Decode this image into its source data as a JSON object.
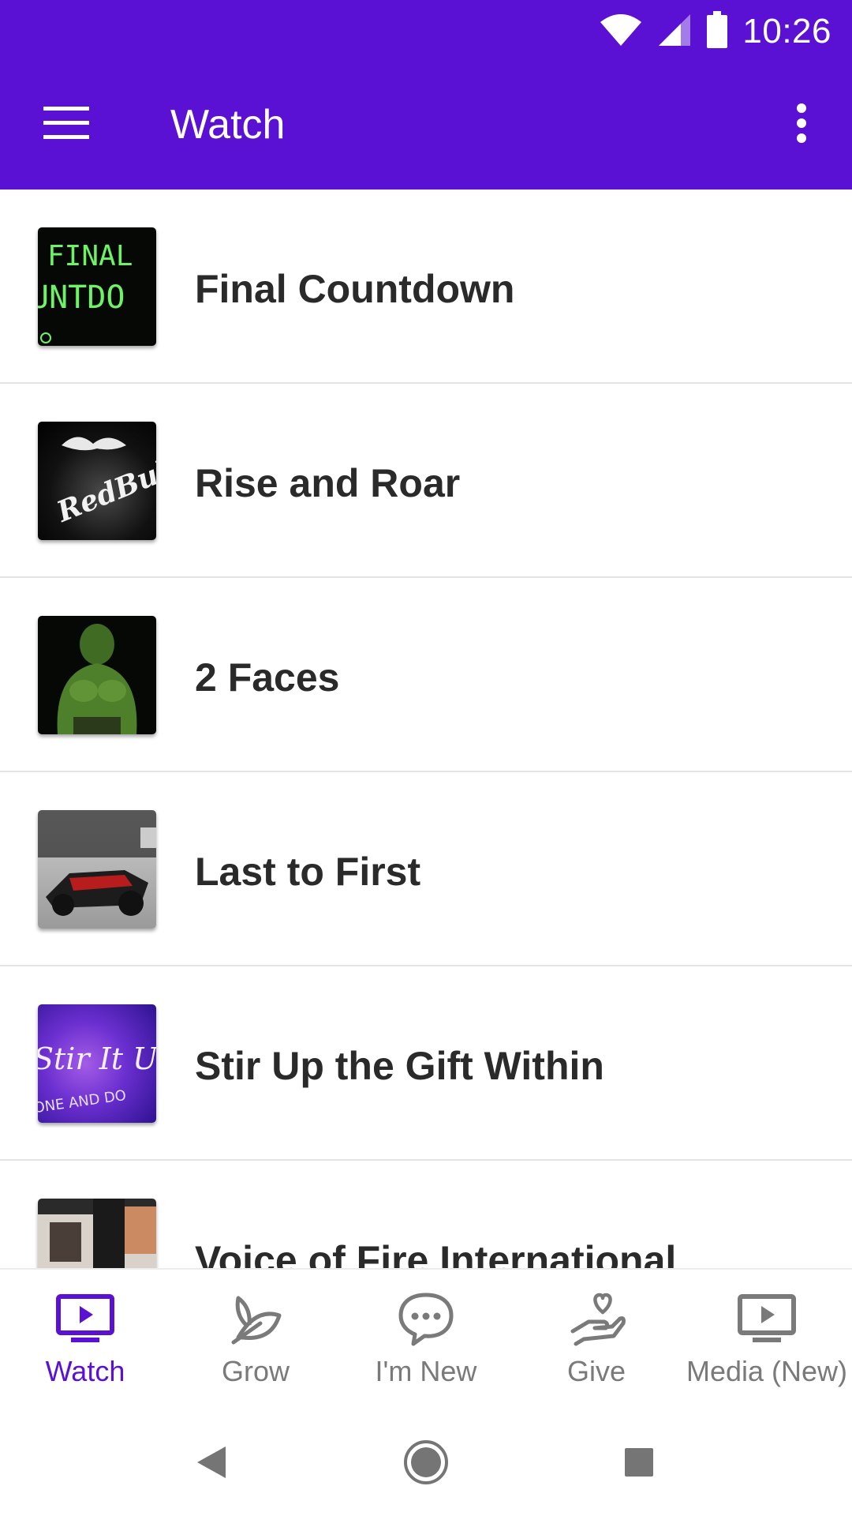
{
  "status_bar": {
    "time": "10:26"
  },
  "app_bar": {
    "title": "Watch"
  },
  "list": [
    {
      "title": "Final Countdown",
      "thumb_text": [
        "FINAL",
        "UNTDO"
      ]
    },
    {
      "title": "Rise and Roar",
      "thumb_text": [
        "RedBull"
      ]
    },
    {
      "title": "2 Faces"
    },
    {
      "title": "Last to First"
    },
    {
      "title": "Stir Up the Gift Within",
      "thumb_text": [
        "Stir It UP",
        "ONE AND DO"
      ]
    },
    {
      "title": "Voice of Fire International"
    }
  ],
  "bottom_nav": [
    {
      "label": "Watch",
      "icon": "tv-play-icon",
      "active": true
    },
    {
      "label": "Grow",
      "icon": "leaf-icon",
      "active": false
    },
    {
      "label": "I'm New",
      "icon": "chat-bubble-icon",
      "active": false
    },
    {
      "label": "Give",
      "icon": "hand-heart-icon",
      "active": false
    },
    {
      "label": "Media (New)",
      "icon": "tv-play-icon",
      "active": false
    }
  ],
  "colors": {
    "primary": "#5a11d4",
    "inactive": "#7a7a7a",
    "text": "#2a2a2a"
  }
}
